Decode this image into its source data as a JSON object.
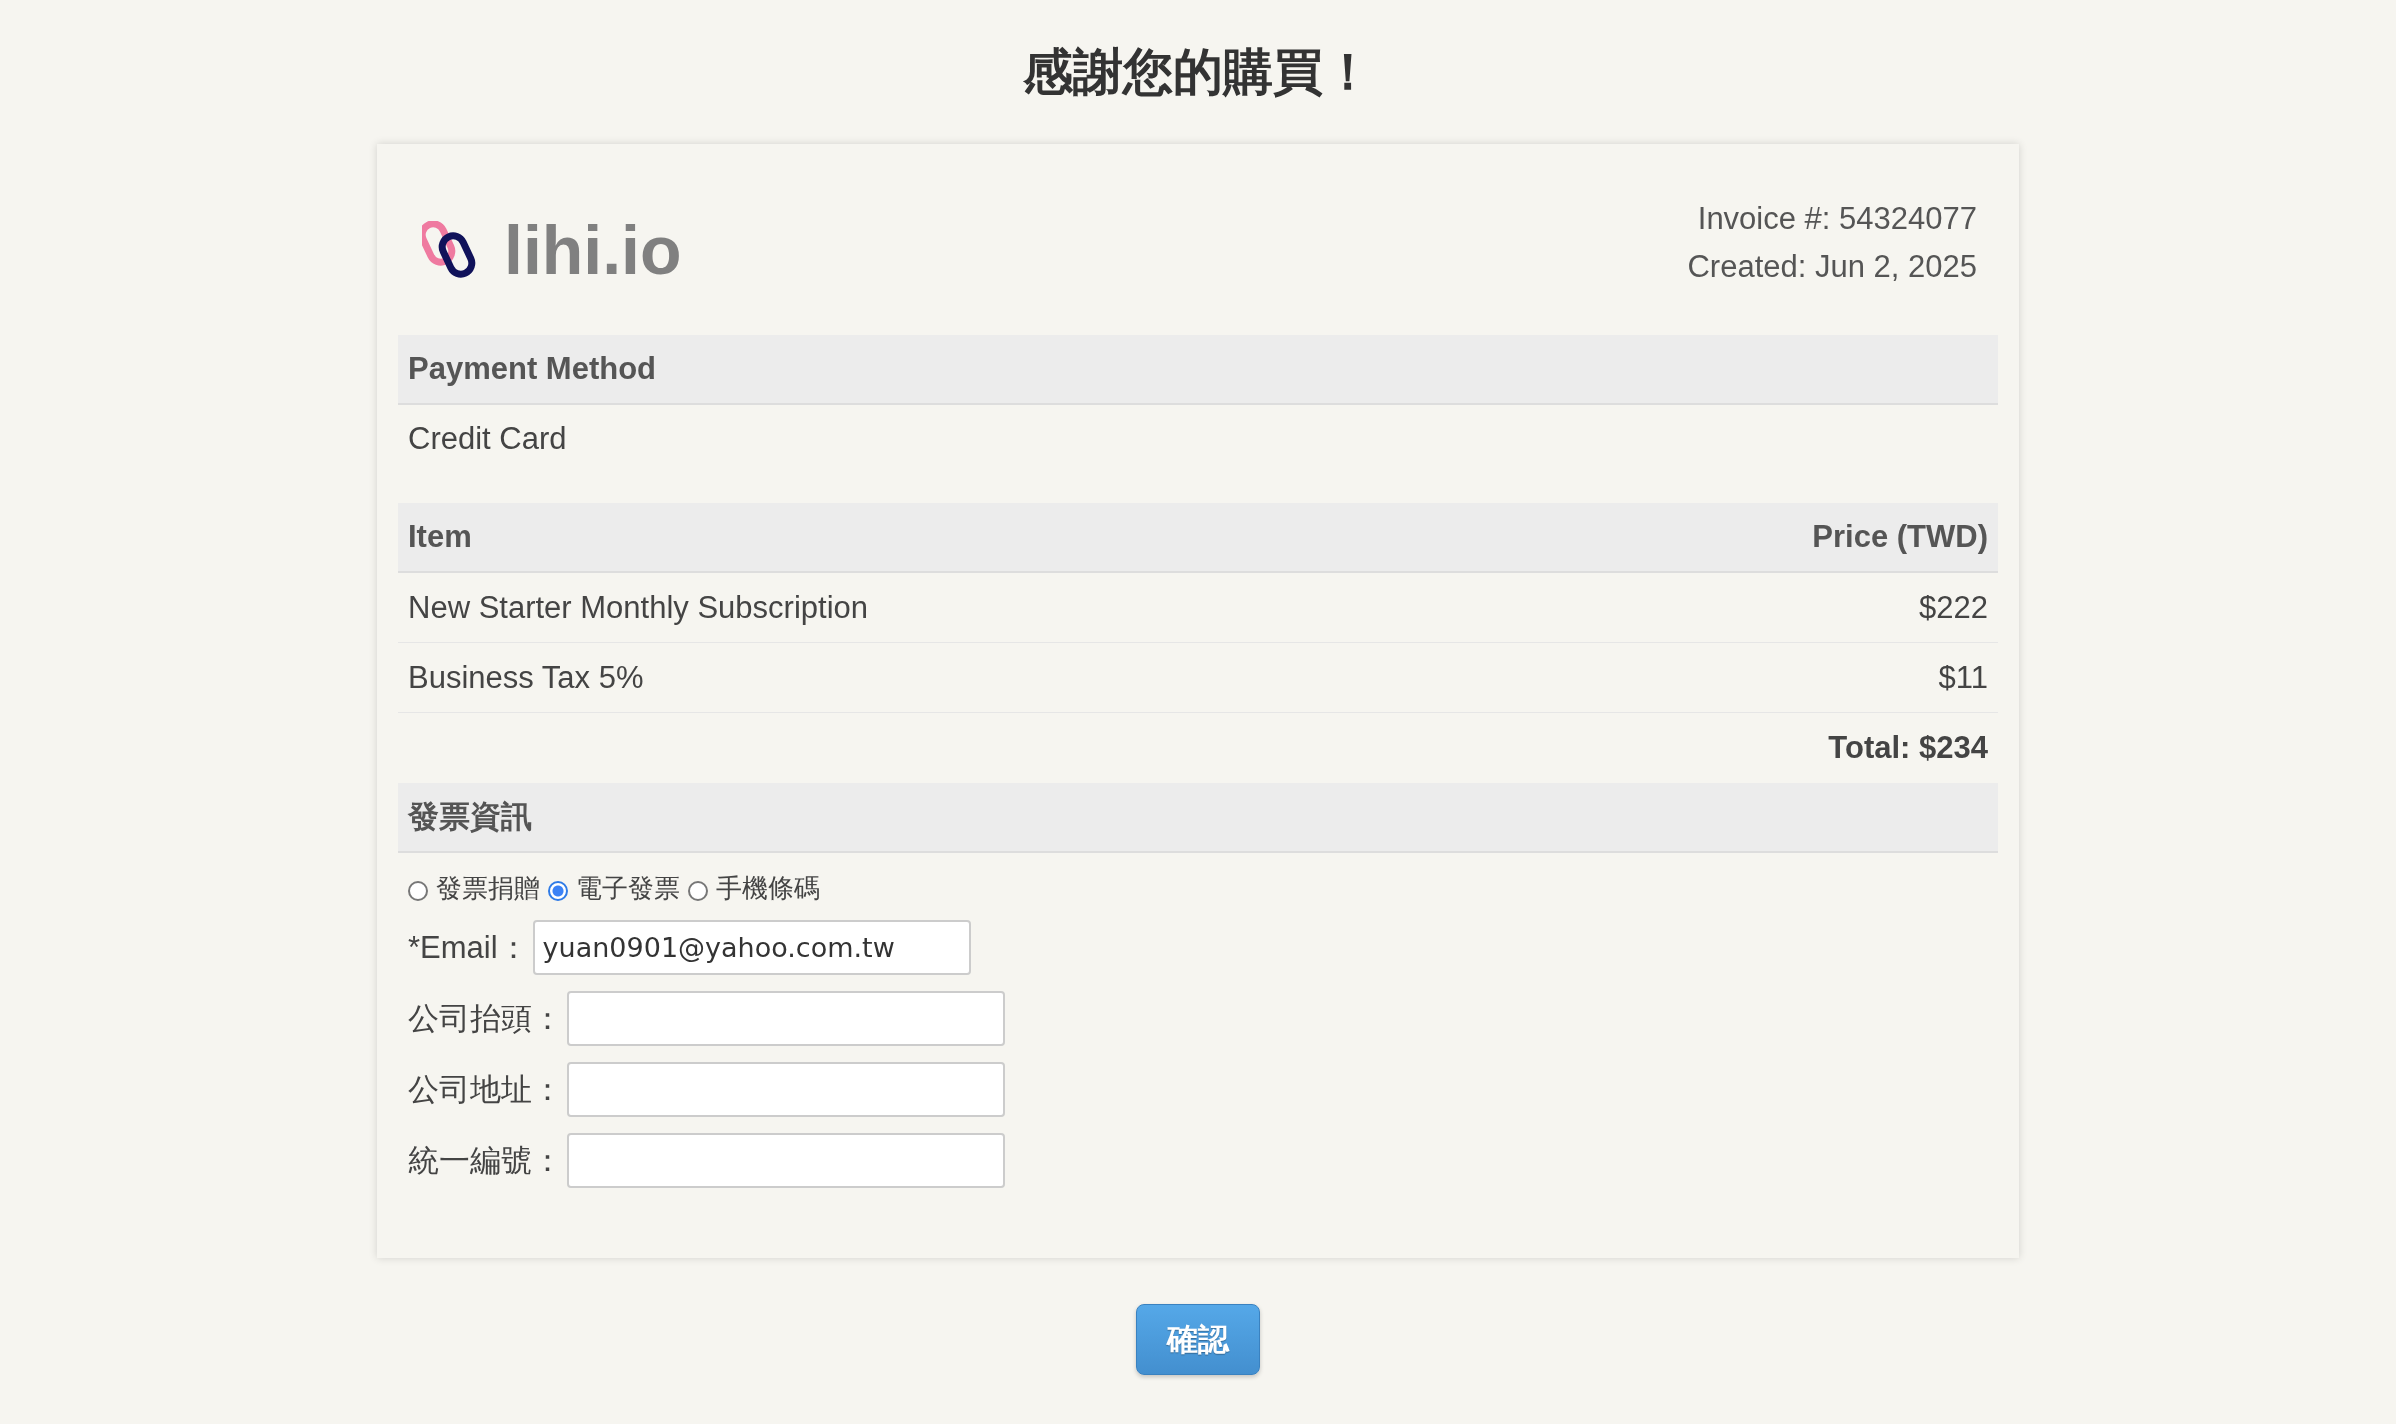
{
  "page": {
    "title": "感謝您的購買！"
  },
  "invoice": {
    "logo_text": "lihi.io",
    "number": "Invoice #: 54324077",
    "created": "Created: Jun 2, 2025"
  },
  "payment": {
    "heading": "Payment Method",
    "value": "Credit Card"
  },
  "items_table": {
    "columns": [
      "Item",
      "Price (TWD)"
    ],
    "rows": [
      {
        "item": "New Starter Monthly Subscription",
        "price": "$222"
      },
      {
        "item": "Business Tax 5%",
        "price": "$11"
      }
    ],
    "total": "Total: $234"
  },
  "invoice_info": {
    "heading": "發票資訊",
    "options": [
      {
        "label": "發票捐贈",
        "selected": false
      },
      {
        "label": "電子發票",
        "selected": true
      },
      {
        "label": "手機條碼",
        "selected": false
      }
    ],
    "fields": [
      {
        "label": "*Email：",
        "value": "yuan0901@yahoo.com.tw"
      },
      {
        "label": "公司抬頭："
      },
      {
        "label": "公司地址："
      },
      {
        "label": "統一編號："
      }
    ]
  },
  "confirm_button": "確認"
}
